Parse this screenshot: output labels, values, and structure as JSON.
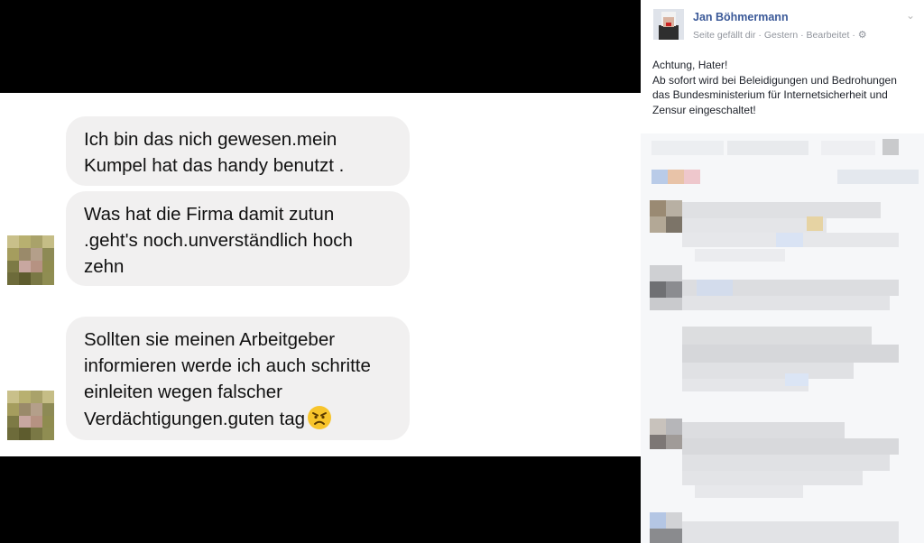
{
  "messages": [
    {
      "lines": [
        "Ich bin das nich gewesen.mein",
        "Kumpel hat das handy benutzt ."
      ]
    },
    {
      "lines": [
        "Was hat die Firma damit zutun",
        ".geht's noch.unverständlich hoch",
        "zehn"
      ]
    },
    {
      "lines": [
        "Sollten sie meinen Arbeitgeber",
        "informieren werde ich auch schritte",
        "einleiten wegen falscher",
        "Verdächtigungen.guten tag"
      ],
      "emoji": "angry-face"
    }
  ],
  "facebook_post": {
    "page_name": "Jan Böhmermann",
    "meta": {
      "liked": "Seite gefällt dir",
      "sep": "·",
      "time": "Gestern",
      "edited": "Bearbeitet",
      "privacy_icon": "gear-icon"
    },
    "text_lines": [
      "Achtung, Hater!",
      "Ab sofort wird bei Beleidigungen und Bedrohungen",
      "das Bundesministerium für Internetsicherheit und",
      "Zensur eingeschaltet!"
    ]
  },
  "colors": {
    "bubble": "#f1f0f0",
    "fb_link": "#3b5998",
    "meta": "#90949c"
  }
}
